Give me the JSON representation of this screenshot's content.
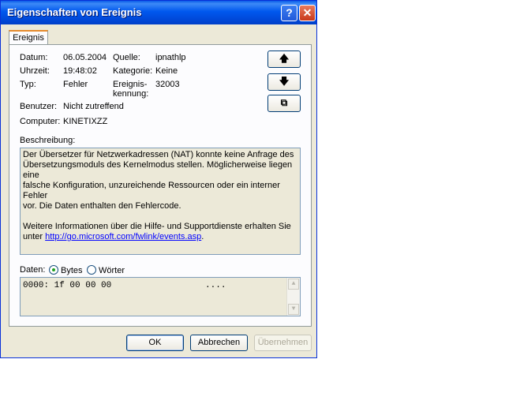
{
  "window": {
    "title": "Eigenschaften von Ereignis",
    "help_label": "?",
    "close_label": "✕"
  },
  "tab": {
    "label": "Ereignis"
  },
  "fields": {
    "datum_label": "Datum:",
    "datum_value": "06.05.2004",
    "uhrzeit_label": "Uhrzeit:",
    "uhrzeit_value": "19:48:02",
    "typ_label": "Typ:",
    "typ_value": "Fehler",
    "benutzer_label": "Benutzer:",
    "benutzer_value": "Nicht zutreffend",
    "computer_label": "Computer:",
    "computer_value": "KINETIXZZ",
    "quelle_label": "Quelle:",
    "quelle_value": "ipnathlp",
    "kategorie_label": "Kategorie:",
    "kategorie_value": "Keine",
    "kennung_label_line1": "Ereignis-",
    "kennung_label_line2": "kennung:",
    "kennung_value": "32003"
  },
  "side_buttons": {
    "up": "🡅",
    "down": "🡇",
    "copy": "⧉"
  },
  "description": {
    "label": "Beschreibung:",
    "line1": "Der Übersetzer für Netzwerkadressen (NAT) konnte  keine Anfrage des",
    "line2": "Übersetzungsmoduls des Kernelmodus stellen. Möglicherweise liegen eine",
    "line3": "falsche Konfiguration, unzureichende Ressourcen oder ein interner Fehler",
    "line4": "vor. Die Daten enthalten den Fehlercode.",
    "line5": "Weitere Informationen über die Hilfe- und Supportdienste erhalten Sie",
    "line6_prefix": "unter ",
    "link": "http://go.microsoft.com/fwlink/events.asp",
    "line6_suffix": "."
  },
  "data_section": {
    "label": "Daten:",
    "option_bytes": "Bytes",
    "option_woerter": "Wörter",
    "selected": "Bytes",
    "line": "0000: 1f 00 00 00                  ...."
  },
  "footer": {
    "ok": "OK",
    "cancel": "Abbrechen",
    "apply": "Übernehmen"
  }
}
